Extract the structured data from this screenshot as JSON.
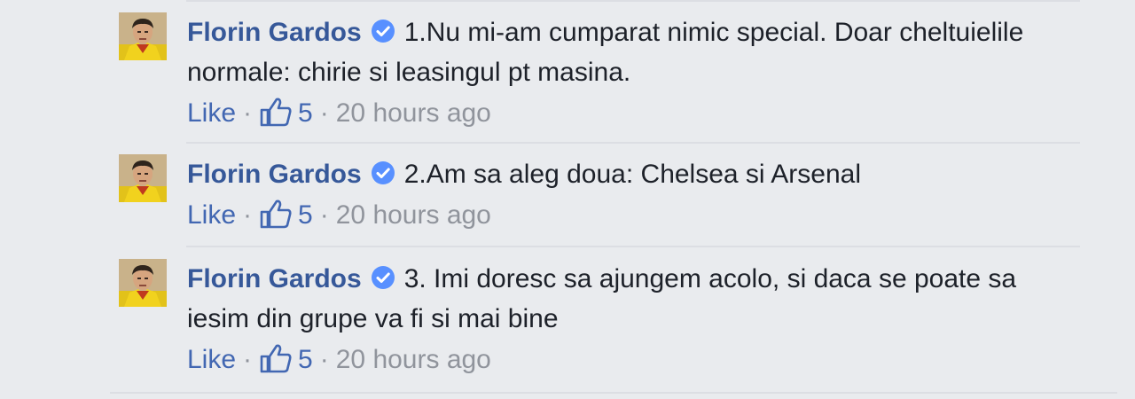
{
  "comments": [
    {
      "author": "Florin Gardos",
      "text": "1.Nu mi-am cumparat nimic special. Doar cheltuielile normale: chirie si leasingul pt masina.",
      "like_label": "Like",
      "like_count": "5",
      "timestamp": "20 hours ago"
    },
    {
      "author": "Florin Gardos",
      "text": "2.Am sa aleg doua: Chelsea si Arsenal",
      "like_label": "Like",
      "like_count": "5",
      "timestamp": "20 hours ago"
    },
    {
      "author": "Florin Gardos",
      "text": "3. Imi doresc sa ajungem acolo, si daca se poate sa iesim din grupe va fi si mai bine",
      "like_label": "Like",
      "like_count": "5",
      "timestamp": "20 hours ago"
    }
  ],
  "separator": "·",
  "colors": {
    "background": "#e9ebee",
    "author": "#365899",
    "link": "#4267b2",
    "meta": "#90949c",
    "text": "#1d2129",
    "verified": "#5890ff"
  },
  "icons": {
    "verified": "verified-badge-icon",
    "like": "thumbs-up-icon"
  }
}
